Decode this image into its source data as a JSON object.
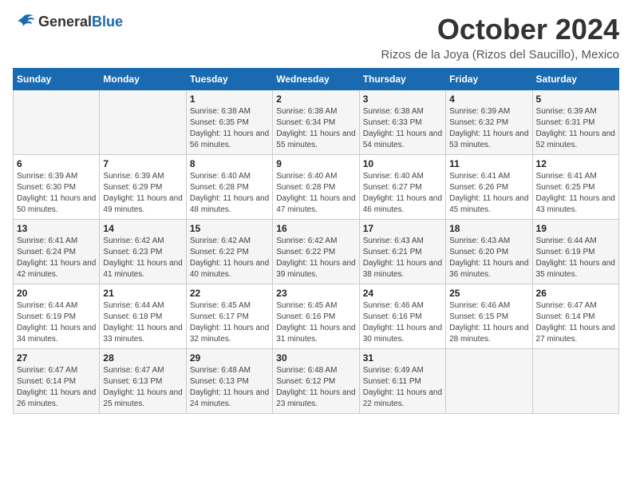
{
  "header": {
    "logo": {
      "general": "General",
      "blue": "Blue"
    },
    "title": "October 2024",
    "location": "Rizos de la Joya (Rizos del Saucillo), Mexico"
  },
  "calendar": {
    "weekdays": [
      "Sunday",
      "Monday",
      "Tuesday",
      "Wednesday",
      "Thursday",
      "Friday",
      "Saturday"
    ],
    "weeks": [
      [
        {
          "day": "",
          "info": ""
        },
        {
          "day": "",
          "info": ""
        },
        {
          "day": "1",
          "info": "Sunrise: 6:38 AM\nSunset: 6:35 PM\nDaylight: 11 hours and 56 minutes."
        },
        {
          "day": "2",
          "info": "Sunrise: 6:38 AM\nSunset: 6:34 PM\nDaylight: 11 hours and 55 minutes."
        },
        {
          "day": "3",
          "info": "Sunrise: 6:38 AM\nSunset: 6:33 PM\nDaylight: 11 hours and 54 minutes."
        },
        {
          "day": "4",
          "info": "Sunrise: 6:39 AM\nSunset: 6:32 PM\nDaylight: 11 hours and 53 minutes."
        },
        {
          "day": "5",
          "info": "Sunrise: 6:39 AM\nSunset: 6:31 PM\nDaylight: 11 hours and 52 minutes."
        }
      ],
      [
        {
          "day": "6",
          "info": "Sunrise: 6:39 AM\nSunset: 6:30 PM\nDaylight: 11 hours and 50 minutes."
        },
        {
          "day": "7",
          "info": "Sunrise: 6:39 AM\nSunset: 6:29 PM\nDaylight: 11 hours and 49 minutes."
        },
        {
          "day": "8",
          "info": "Sunrise: 6:40 AM\nSunset: 6:28 PM\nDaylight: 11 hours and 48 minutes."
        },
        {
          "day": "9",
          "info": "Sunrise: 6:40 AM\nSunset: 6:28 PM\nDaylight: 11 hours and 47 minutes."
        },
        {
          "day": "10",
          "info": "Sunrise: 6:40 AM\nSunset: 6:27 PM\nDaylight: 11 hours and 46 minutes."
        },
        {
          "day": "11",
          "info": "Sunrise: 6:41 AM\nSunset: 6:26 PM\nDaylight: 11 hours and 45 minutes."
        },
        {
          "day": "12",
          "info": "Sunrise: 6:41 AM\nSunset: 6:25 PM\nDaylight: 11 hours and 43 minutes."
        }
      ],
      [
        {
          "day": "13",
          "info": "Sunrise: 6:41 AM\nSunset: 6:24 PM\nDaylight: 11 hours and 42 minutes."
        },
        {
          "day": "14",
          "info": "Sunrise: 6:42 AM\nSunset: 6:23 PM\nDaylight: 11 hours and 41 minutes."
        },
        {
          "day": "15",
          "info": "Sunrise: 6:42 AM\nSunset: 6:22 PM\nDaylight: 11 hours and 40 minutes."
        },
        {
          "day": "16",
          "info": "Sunrise: 6:42 AM\nSunset: 6:22 PM\nDaylight: 11 hours and 39 minutes."
        },
        {
          "day": "17",
          "info": "Sunrise: 6:43 AM\nSunset: 6:21 PM\nDaylight: 11 hours and 38 minutes."
        },
        {
          "day": "18",
          "info": "Sunrise: 6:43 AM\nSunset: 6:20 PM\nDaylight: 11 hours and 36 minutes."
        },
        {
          "day": "19",
          "info": "Sunrise: 6:44 AM\nSunset: 6:19 PM\nDaylight: 11 hours and 35 minutes."
        }
      ],
      [
        {
          "day": "20",
          "info": "Sunrise: 6:44 AM\nSunset: 6:19 PM\nDaylight: 11 hours and 34 minutes."
        },
        {
          "day": "21",
          "info": "Sunrise: 6:44 AM\nSunset: 6:18 PM\nDaylight: 11 hours and 33 minutes."
        },
        {
          "day": "22",
          "info": "Sunrise: 6:45 AM\nSunset: 6:17 PM\nDaylight: 11 hours and 32 minutes."
        },
        {
          "day": "23",
          "info": "Sunrise: 6:45 AM\nSunset: 6:16 PM\nDaylight: 11 hours and 31 minutes."
        },
        {
          "day": "24",
          "info": "Sunrise: 6:46 AM\nSunset: 6:16 PM\nDaylight: 11 hours and 30 minutes."
        },
        {
          "day": "25",
          "info": "Sunrise: 6:46 AM\nSunset: 6:15 PM\nDaylight: 11 hours and 28 minutes."
        },
        {
          "day": "26",
          "info": "Sunrise: 6:47 AM\nSunset: 6:14 PM\nDaylight: 11 hours and 27 minutes."
        }
      ],
      [
        {
          "day": "27",
          "info": "Sunrise: 6:47 AM\nSunset: 6:14 PM\nDaylight: 11 hours and 26 minutes."
        },
        {
          "day": "28",
          "info": "Sunrise: 6:47 AM\nSunset: 6:13 PM\nDaylight: 11 hours and 25 minutes."
        },
        {
          "day": "29",
          "info": "Sunrise: 6:48 AM\nSunset: 6:13 PM\nDaylight: 11 hours and 24 minutes."
        },
        {
          "day": "30",
          "info": "Sunrise: 6:48 AM\nSunset: 6:12 PM\nDaylight: 11 hours and 23 minutes."
        },
        {
          "day": "31",
          "info": "Sunrise: 6:49 AM\nSunset: 6:11 PM\nDaylight: 11 hours and 22 minutes."
        },
        {
          "day": "",
          "info": ""
        },
        {
          "day": "",
          "info": ""
        }
      ]
    ]
  }
}
